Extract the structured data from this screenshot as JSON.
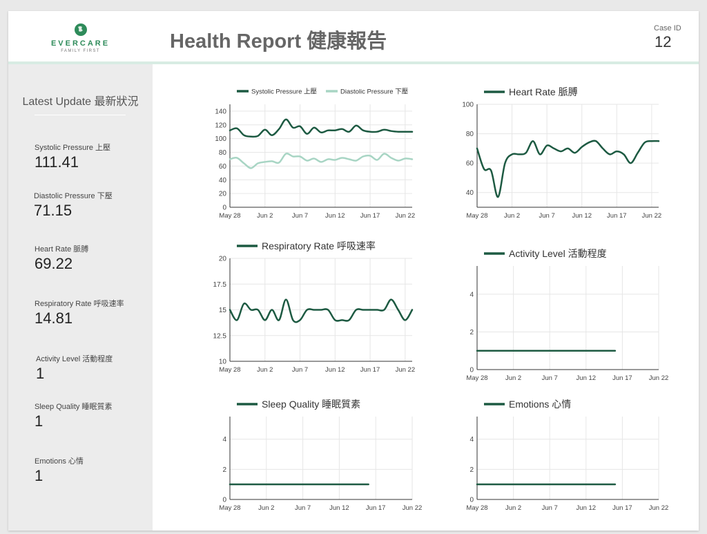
{
  "header": {
    "brand": "EVERCARE",
    "tagline": "FAMILY FIRST",
    "title": "Health Report 健康報告",
    "case_id_label": "Case ID",
    "case_id_value": "12"
  },
  "colors": {
    "primary": "#1d5a42",
    "secondary": "#a8d5c4",
    "brand": "#2e8b5a",
    "grid": "#e6e6e6"
  },
  "sidebar": {
    "title": "Latest Update 最新狀況",
    "metrics": [
      {
        "label": "Systolic Pressure 上壓",
        "value": "111.41"
      },
      {
        "label": "Diastolic Pressure 下壓",
        "value": "71.15"
      },
      {
        "label": "Heart Rate 脈膊",
        "value": "69.22"
      },
      {
        "label": "Respiratory Rate 呼吸速率",
        "value": "14.81"
      },
      {
        "label": "Activity Level 活動程度",
        "value": "1"
      },
      {
        "label": "Sleep Quality 睡眠質素",
        "value": "1"
      },
      {
        "label": "Emotions 心情",
        "value": "1"
      }
    ]
  },
  "chart_data": [
    {
      "type": "line",
      "legend": "top",
      "grid": true,
      "x_ticks": [
        "May 28",
        "Jun 2",
        "Jun 7",
        "Jun 12",
        "Jun 17",
        "Jun 22"
      ],
      "x_range": [
        "May 28",
        "Jun 23"
      ],
      "ylim": [
        0,
        150
      ],
      "y_ticks": [
        "0",
        "20",
        "40",
        "60",
        "80",
        "100",
        "120",
        "140"
      ],
      "y_tick_values": [
        0,
        20,
        40,
        60,
        80,
        100,
        120,
        140
      ],
      "series": [
        {
          "name": "Systolic Pressure 上壓",
          "color": "#1d5a42",
          "x": [
            "May 28",
            "May 29",
            "May 30",
            "May 31",
            "Jun 1",
            "Jun 2",
            "Jun 3",
            "Jun 4",
            "Jun 5",
            "Jun 6",
            "Jun 7",
            "Jun 8",
            "Jun 9",
            "Jun 10",
            "Jun 11",
            "Jun 12",
            "Jun 13",
            "Jun 14",
            "Jun 15",
            "Jun 16",
            "Jun 17",
            "Jun 18",
            "Jun 19",
            "Jun 20",
            "Jun 21",
            "Jun 22",
            "Jun 23"
          ],
          "y": [
            112,
            115,
            105,
            103,
            104,
            113,
            105,
            114,
            128,
            116,
            118,
            107,
            116,
            109,
            112,
            112,
            114,
            110,
            119,
            112,
            110,
            110,
            113,
            111,
            110,
            110,
            110
          ]
        },
        {
          "name": "Diastolic Pressure 下壓",
          "color": "#a8d5c4",
          "x": [
            "May 28",
            "May 29",
            "May 30",
            "May 31",
            "Jun 1",
            "Jun 2",
            "Jun 3",
            "Jun 4",
            "Jun 5",
            "Jun 6",
            "Jun 7",
            "Jun 8",
            "Jun 9",
            "Jun 10",
            "Jun 11",
            "Jun 12",
            "Jun 13",
            "Jun 14",
            "Jun 15",
            "Jun 16",
            "Jun 17",
            "Jun 18",
            "Jun 19",
            "Jun 20",
            "Jun 21",
            "Jun 22",
            "Jun 23"
          ],
          "y": [
            70,
            72,
            64,
            57,
            64,
            66,
            67,
            65,
            78,
            74,
            74,
            68,
            71,
            66,
            70,
            69,
            72,
            70,
            68,
            74,
            75,
            69,
            78,
            72,
            68,
            71,
            70
          ]
        }
      ]
    },
    {
      "type": "line",
      "legend": "top",
      "grid": true,
      "x_ticks": [
        "May 28",
        "Jun 2",
        "Jun 7",
        "Jun 12",
        "Jun 17",
        "Jun 22"
      ],
      "x_range": [
        "May 28",
        "Jun 23"
      ],
      "ylim": [
        30,
        100
      ],
      "y_ticks": [
        "40",
        "60",
        "80",
        "100"
      ],
      "y_tick_values": [
        40,
        60,
        80,
        100
      ],
      "series": [
        {
          "name": "Heart Rate 脈膊",
          "color": "#1d5a42",
          "x": [
            "May 28",
            "May 29",
            "May 30",
            "May 31",
            "Jun 1",
            "Jun 2",
            "Jun 3",
            "Jun 4",
            "Jun 5",
            "Jun 6",
            "Jun 7",
            "Jun 8",
            "Jun 9",
            "Jun 10",
            "Jun 11",
            "Jun 12",
            "Jun 13",
            "Jun 14",
            "Jun 15",
            "Jun 16",
            "Jun 17",
            "Jun 18",
            "Jun 19",
            "Jun 20",
            "Jun 21",
            "Jun 22",
            "Jun 23"
          ],
          "y": [
            70,
            56,
            55,
            37,
            60,
            66,
            66,
            67,
            75,
            66,
            72,
            70,
            68,
            70,
            67,
            71,
            74,
            75,
            70,
            66,
            68,
            66,
            60,
            67,
            74,
            75,
            75
          ]
        }
      ]
    },
    {
      "type": "line",
      "legend": "top",
      "grid": true,
      "x_ticks": [
        "May 28",
        "Jun 2",
        "Jun 7",
        "Jun 12",
        "Jun 17",
        "Jun 22"
      ],
      "x_range": [
        "May 28",
        "Jun 23"
      ],
      "ylim": [
        10,
        20
      ],
      "y_ticks": [
        "10",
        "12.5",
        "15",
        "17.5",
        "20"
      ],
      "y_tick_values": [
        10,
        12.5,
        15,
        17.5,
        20
      ],
      "series": [
        {
          "name": "Respiratory Rate 呼吸速率",
          "color": "#1d5a42",
          "x": [
            "May 28",
            "May 29",
            "May 30",
            "May 31",
            "Jun 1",
            "Jun 2",
            "Jun 3",
            "Jun 4",
            "Jun 5",
            "Jun 6",
            "Jun 7",
            "Jun 8",
            "Jun 9",
            "Jun 10",
            "Jun 11",
            "Jun 12",
            "Jun 13",
            "Jun 14",
            "Jun 15",
            "Jun 16",
            "Jun 17",
            "Jun 18",
            "Jun 19",
            "Jun 20",
            "Jun 21",
            "Jun 22",
            "Jun 23"
          ],
          "y": [
            15,
            14,
            15.6,
            15,
            15,
            14,
            15,
            14,
            16,
            14,
            14,
            15,
            15,
            15,
            15,
            14,
            14,
            14,
            15,
            15,
            15,
            15,
            15,
            16,
            15,
            14,
            15
          ]
        }
      ]
    },
    {
      "type": "line",
      "legend": "top",
      "grid": true,
      "x_ticks": [
        "May 28",
        "Jun 2",
        "Jun 7",
        "Jun 12",
        "Jun 17",
        "Jun 22"
      ],
      "x_range": [
        "May 28",
        "Jun 22"
      ],
      "ylim": [
        0,
        5.5
      ],
      "y_ticks": [
        "0",
        "2",
        "4"
      ],
      "y_tick_values": [
        0,
        2,
        4
      ],
      "series": [
        {
          "name": "Activity Level 活動程度",
          "color": "#1d5a42",
          "x": [
            "May 28",
            "Jun 16"
          ],
          "y": [
            1,
            1
          ]
        }
      ]
    },
    {
      "type": "line",
      "legend": "top",
      "grid": true,
      "x_ticks": [
        "May 28",
        "Jun 2",
        "Jun 7",
        "Jun 12",
        "Jun 17",
        "Jun 22"
      ],
      "x_range": [
        "May 28",
        "Jun 22"
      ],
      "ylim": [
        0,
        5.5
      ],
      "y_ticks": [
        "0",
        "2",
        "4"
      ],
      "y_tick_values": [
        0,
        2,
        4
      ],
      "series": [
        {
          "name": "Sleep Quality 睡眠質素",
          "color": "#1d5a42",
          "x": [
            "May 28",
            "Jun 16"
          ],
          "y": [
            1,
            1
          ]
        }
      ]
    },
    {
      "type": "line",
      "legend": "top",
      "grid": true,
      "x_ticks": [
        "May 28",
        "Jun 2",
        "Jun 7",
        "Jun 12",
        "Jun 17",
        "Jun 22"
      ],
      "x_range": [
        "May 28",
        "Jun 22"
      ],
      "ylim": [
        0,
        5.5
      ],
      "y_ticks": [
        "0",
        "2",
        "4"
      ],
      "y_tick_values": [
        0,
        2,
        4
      ],
      "series": [
        {
          "name": "Emotions 心情",
          "color": "#1d5a42",
          "x": [
            "May 28",
            "Jun 16"
          ],
          "y": [
            1,
            1
          ]
        }
      ]
    }
  ]
}
